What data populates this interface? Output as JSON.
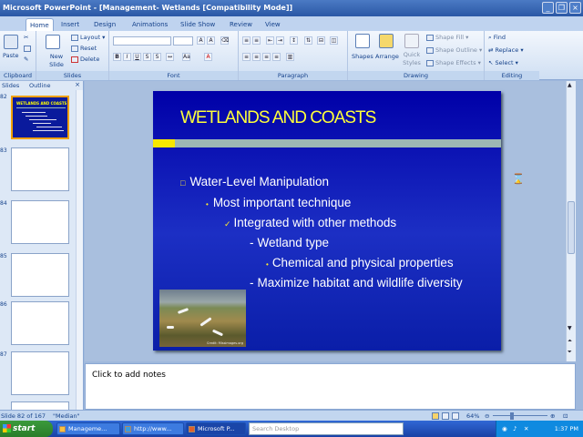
{
  "window": {
    "title": "Microsoft PowerPoint - [Management- Wetlands [Compatibility Mode]]"
  },
  "ribbon_tabs": [
    "Home",
    "Insert",
    "Design",
    "Animations",
    "Slide Show",
    "Review",
    "View"
  ],
  "ribbon": {
    "clipboard": {
      "label": "Clipboard",
      "paste": "Paste"
    },
    "slides": {
      "label": "Slides",
      "new_slide": "New Slide",
      "layout": "Layout",
      "reset": "Reset",
      "delete": "Delete"
    },
    "font": {
      "label": "Font"
    },
    "paragraph": {
      "label": "Paragraph"
    },
    "drawing": {
      "label": "Drawing",
      "shapes": "Shapes",
      "arrange": "Arrange",
      "quick_styles": "Quick Styles",
      "shape_fill": "Shape Fill",
      "shape_outline": "Shape Outline",
      "shape_effects": "Shape Effects"
    },
    "editing": {
      "label": "Editing",
      "find": "Find",
      "replace": "Replace",
      "select": "Select"
    }
  },
  "left_pane": {
    "tabs": [
      "Slides",
      "Outline"
    ],
    "close": "×",
    "slide_numbers": [
      "82",
      "83",
      "84",
      "85",
      "86",
      "87"
    ],
    "thumb_title": "WETLANDS AND COASTS"
  },
  "slide": {
    "title": "WETLANDS AND COASTS",
    "bullets": [
      {
        "marker": "□",
        "text": "Water-Level Manipulation"
      },
      {
        "marker": "•",
        "text": "Most important technique"
      },
      {
        "marker": "✓",
        "text": "Integrated with other methods"
      },
      {
        "marker": "-",
        "text": "Wetland type"
      },
      {
        "marker": "•",
        "text": "Chemical and physical properties"
      },
      {
        "marker": "-",
        "text": "Maximize habitat and wildlife diversity"
      }
    ],
    "photo_caption": "Credit: Missimages.org"
  },
  "notes": {
    "placeholder": "Click to add notes"
  },
  "status": {
    "slide": "Slide 82 of 167",
    "theme": "\"Median\"",
    "zoom": "64%"
  },
  "taskbar": {
    "start": "start",
    "buttons": [
      "Manageme...",
      "http://www...",
      "Microsoft P..."
    ],
    "search_placeholder": "Search Desktop",
    "clock": "1:37 PM"
  },
  "colors": {
    "slide_bg": "#0000a8",
    "title": "#ffff3a",
    "accent_bar": "#f7e800"
  }
}
